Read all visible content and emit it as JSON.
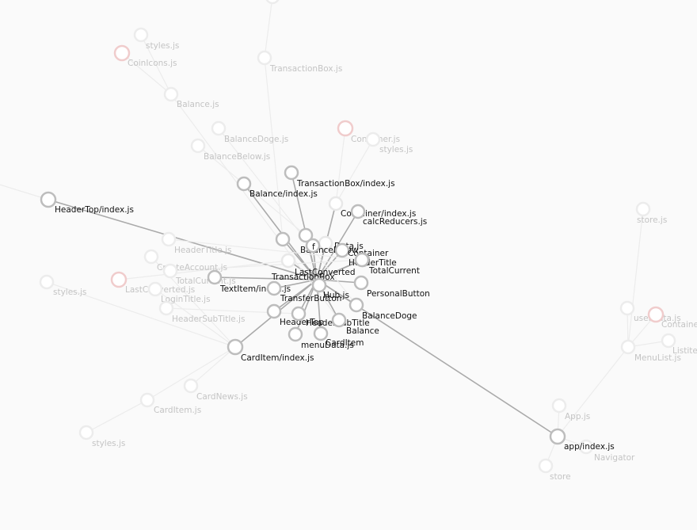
{
  "colors": {
    "background": "#fafafa",
    "active_edge": "#aaaaaa",
    "faded_edge": "#ececec",
    "active_node_stroke": "#bdbdbd",
    "faded_node_stroke": "#ececec",
    "highlight_fill": "#cc4444",
    "faded_highlight_fill": "#f0cccc",
    "active_label": "#111111",
    "faded_label": "#c4c4c4"
  },
  "graph": {
    "nodes": [
      {
        "id": "center",
        "label": "",
        "state": "active"
      },
      {
        "id": "header_top",
        "label": "HeaderTop/index.js",
        "state": "active"
      },
      {
        "id": "app_index",
        "label": "app/index.js",
        "state": "active"
      },
      {
        "id": "card_item_index",
        "label": "CardItem/index.js",
        "state": "active"
      },
      {
        "id": "balance_index",
        "label": "Balance/index.js",
        "state": "active"
      },
      {
        "id": "transaction_box_index",
        "label": "TransactionBox/index.js",
        "state": "active"
      },
      {
        "id": "container_index",
        "label": "Container/index.js",
        "state": "active-highlight"
      },
      {
        "id": "calc_reducers",
        "label": "calcReducers.js",
        "state": "active"
      },
      {
        "id": "data_js",
        "label": "Data.js",
        "state": "active-highlight"
      },
      {
        "id": "balance_below",
        "label": "BalanceBelow",
        "state": "active"
      },
      {
        "id": "f_partial",
        "label": "f",
        "state": "active"
      },
      {
        "id": "container",
        "label": "Container",
        "state": "active"
      },
      {
        "id": "header_title",
        "label": "HeaderTitle",
        "state": "active"
      },
      {
        "id": "total_current",
        "label": "TotalCurrent",
        "state": "active"
      },
      {
        "id": "last_converted",
        "label": "LastConverted",
        "state": "active-highlight"
      },
      {
        "id": "transaction_box",
        "label": "TransactionBox",
        "state": "active"
      },
      {
        "id": "text_item",
        "label": "TextItem/index.js",
        "state": "active"
      },
      {
        "id": "personal_button",
        "label": "PersonalButton",
        "state": "active"
      },
      {
        "id": "transfer_button",
        "label": "TransferButton",
        "state": "active"
      },
      {
        "id": "hub_js",
        "label": "Hub.js",
        "state": "active"
      },
      {
        "id": "balance_doge",
        "label": "BalanceDoge",
        "state": "active"
      },
      {
        "id": "header_top_short",
        "label": "HeaderTop",
        "state": "active"
      },
      {
        "id": "header_sub_title",
        "label": "HeaderSubTitle",
        "state": "active"
      },
      {
        "id": "balance",
        "label": "Balance",
        "state": "active"
      },
      {
        "id": "menu_data",
        "label": "menuData.js",
        "state": "active"
      },
      {
        "id": "card_item",
        "label": "CardItem",
        "state": "active"
      },
      {
        "id": "styles_top",
        "label": "styles.js",
        "state": "faded"
      },
      {
        "id": "styles_js_1",
        "label": "styles.js",
        "state": "faded"
      },
      {
        "id": "coin_icons",
        "label": "CoinIcons.js",
        "state": "faded-highlight"
      },
      {
        "id": "transaction_box_js",
        "label": "TransactionBox.js",
        "state": "faded"
      },
      {
        "id": "balance_js",
        "label": "Balance.js",
        "state": "faded"
      },
      {
        "id": "balance_doge_js",
        "label": "BalanceDoge.js",
        "state": "faded"
      },
      {
        "id": "balance_below_js",
        "label": "BalanceBelow.js",
        "state": "faded"
      },
      {
        "id": "container_js",
        "label": "Container.js",
        "state": "faded-highlight"
      },
      {
        "id": "styles_js_2",
        "label": "styles.js",
        "state": "faded"
      },
      {
        "id": "header_title_js",
        "label": "HeaderTitle.js",
        "state": "faded"
      },
      {
        "id": "create_account_js",
        "label": "CreateAccount.js",
        "state": "faded"
      },
      {
        "id": "total_current_js",
        "label": "TotalCurrent.js",
        "state": "faded"
      },
      {
        "id": "last_converted_js",
        "label": "LastConverted.js",
        "state": "faded-highlight"
      },
      {
        "id": "styles_js_3",
        "label": "styles.js",
        "state": "faded"
      },
      {
        "id": "login_title_js",
        "label": "LoginTitle.js",
        "state": "faded"
      },
      {
        "id": "header_sub_title_js",
        "label": "HeaderSubTitle.js",
        "state": "faded"
      },
      {
        "id": "card_news_js",
        "label": "CardNews.js",
        "state": "faded"
      },
      {
        "id": "card_item_js",
        "label": "CardItem.js",
        "state": "faded"
      },
      {
        "id": "styles_js_4",
        "label": "styles.js",
        "state": "faded"
      },
      {
        "id": "store_js",
        "label": "store.js",
        "state": "faded"
      },
      {
        "id": "user_data_js",
        "label": "userData.js",
        "state": "faded"
      },
      {
        "id": "containe_partial",
        "label": "Containe",
        "state": "faded-highlight"
      },
      {
        "id": "listite_partial",
        "label": "Listite",
        "state": "faded"
      },
      {
        "id": "menu_list_js",
        "label": "MenuList.js",
        "state": "faded"
      },
      {
        "id": "app_js",
        "label": "App.js",
        "state": "faded"
      },
      {
        "id": "navigator",
        "label": "Navigator",
        "state": "faded"
      },
      {
        "id": "store",
        "label": "store",
        "state": "faded"
      }
    ],
    "edges": [
      [
        "center",
        "header_top"
      ],
      [
        "center",
        "app_index"
      ],
      [
        "center",
        "card_item_index"
      ],
      [
        "center",
        "balance_index"
      ],
      [
        "center",
        "transaction_box_index"
      ],
      [
        "center",
        "container_index"
      ],
      [
        "center",
        "calc_reducers"
      ],
      [
        "center",
        "data_js"
      ],
      [
        "center",
        "balance_below"
      ],
      [
        "center",
        "f_partial"
      ],
      [
        "center",
        "container"
      ],
      [
        "center",
        "header_title"
      ],
      [
        "center",
        "total_current"
      ],
      [
        "center",
        "last_converted"
      ],
      [
        "center",
        "transaction_box"
      ],
      [
        "center",
        "text_item"
      ],
      [
        "center",
        "personal_button"
      ],
      [
        "center",
        "transfer_button"
      ],
      [
        "center",
        "hub_js"
      ],
      [
        "center",
        "balance_doge"
      ],
      [
        "center",
        "header_top_short"
      ],
      [
        "center",
        "header_sub_title"
      ],
      [
        "center",
        "balance"
      ],
      [
        "center",
        "menu_data"
      ],
      [
        "center",
        "card_item"
      ],
      [
        "styles_top",
        "transaction_box_js"
      ],
      [
        "transaction_box_js",
        "transaction_box"
      ],
      [
        "coin_icons",
        "balance_js"
      ],
      [
        "styles_js_1",
        "balance_js"
      ],
      [
        "balance_js",
        "balance"
      ],
      [
        "balance_doge_js",
        "balance_doge"
      ],
      [
        "balance_below_js",
        "balance_below"
      ],
      [
        "container_js",
        "container_index"
      ],
      [
        "styles_js_2",
        "container_index"
      ],
      [
        "header_title_js",
        "header_title"
      ],
      [
        "create_account_js",
        "card_item_index"
      ],
      [
        "total_current_js",
        "total_current"
      ],
      [
        "last_converted_js",
        "last_converted"
      ],
      [
        "login_title_js",
        "card_item_index"
      ],
      [
        "header_sub_title_js",
        "header_sub_title"
      ],
      [
        "styles_js_3",
        "card_item_index"
      ],
      [
        "card_news_js",
        "card_item_index"
      ],
      [
        "card_item_js",
        "card_item_index"
      ],
      [
        "styles_js_4",
        "card_item_js"
      ],
      [
        "app_js",
        "app_index"
      ],
      [
        "navigator",
        "app_index"
      ],
      [
        "store",
        "app_index"
      ],
      [
        "menu_list_js",
        "app_index"
      ],
      [
        "user_data_js",
        "menu_list_js"
      ],
      [
        "containe_partial",
        "menu_list_js"
      ],
      [
        "listite_partial",
        "menu_list_js"
      ],
      [
        "store_js",
        "menu_list_js"
      ],
      [
        "header_top",
        "off_left"
      ]
    ]
  }
}
